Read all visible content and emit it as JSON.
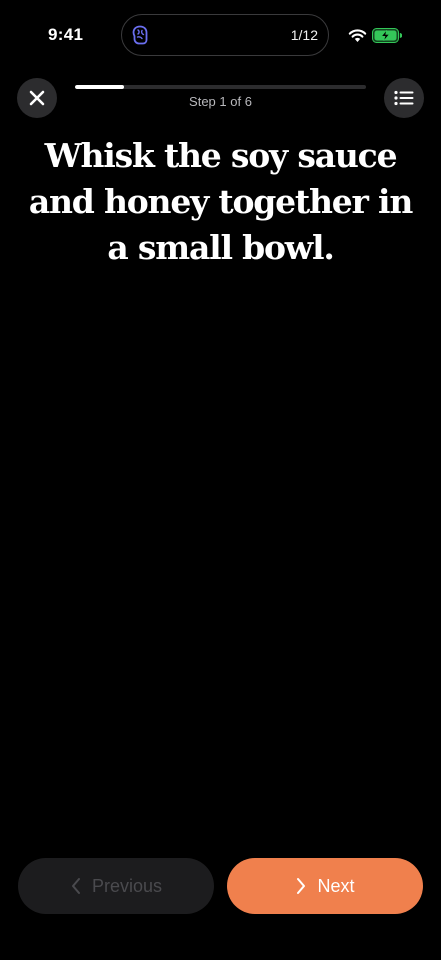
{
  "status_bar": {
    "time": "9:41",
    "island_counter": "1/12",
    "island_icon": "brain-icon",
    "wifi_icon": "wifi-icon",
    "battery_icon": "battery-charging-icon",
    "battery_color": "#34c759"
  },
  "header": {
    "close_icon": "close-icon",
    "list_icon": "list-icon",
    "step_label": "Step 1 of 6",
    "progress": 0.167
  },
  "main": {
    "instruction": "Whisk the soy sauce and honey together in a small bowl."
  },
  "footer": {
    "previous_label": "Previous",
    "next_label": "Next",
    "previous_icon": "chevron-left-icon",
    "next_icon": "chevron-right-icon",
    "next_color": "#f0804d",
    "previous_enabled": false
  }
}
